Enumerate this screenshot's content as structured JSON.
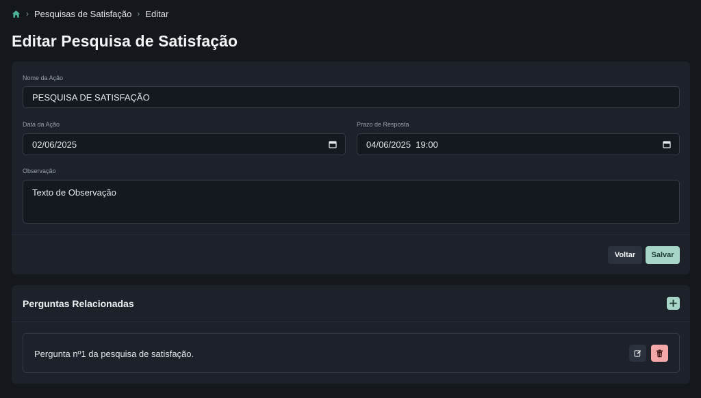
{
  "breadcrumb": {
    "items": [
      "Pesquisas de Satisfação",
      "Editar"
    ],
    "separator": "›"
  },
  "page": {
    "title": "Editar Pesquisa de Satisfação"
  },
  "form": {
    "nome_acao": {
      "label": "Nome da Ação",
      "value": "PESQUISA DE SATISFAÇÃO"
    },
    "data_acao": {
      "label": "Data da Ação",
      "value": "02/06/2025"
    },
    "prazo_resposta": {
      "label": "Prazo de Resposta",
      "value": "04/06/2025  19:00"
    },
    "observacao": {
      "label": "Observação",
      "value": "Texto de Observação"
    },
    "buttons": {
      "back": "Voltar",
      "save": "Salvar"
    }
  },
  "questions": {
    "title": "Perguntas Relacionadas",
    "items": [
      {
        "text": "Pergunta nº1 da pesquisa de satisfação."
      }
    ]
  },
  "colors": {
    "background": "#14171c",
    "card": "#1c212a",
    "accent": "#a7d6c8",
    "danger": "#f4a7a7"
  },
  "icons": [
    "home-icon",
    "calendar-icon",
    "plus-icon",
    "edit-icon",
    "trash-icon"
  ]
}
